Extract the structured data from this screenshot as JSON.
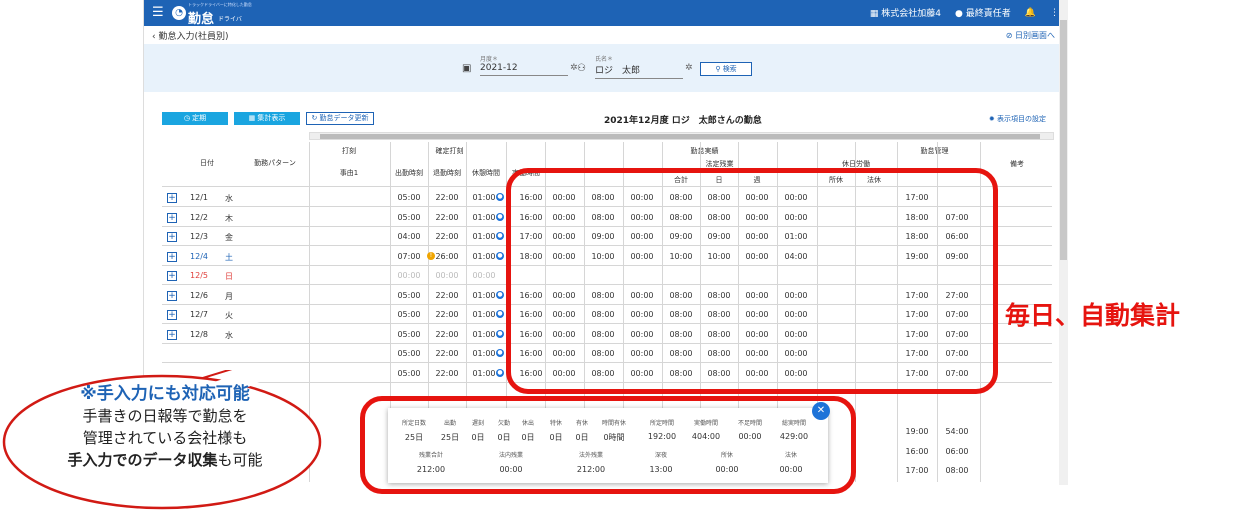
{
  "header": {
    "logo_sub": "トラックドライバーに特化した勤怠",
    "logo_main": "勤怠",
    "logo_small": "ドライバー",
    "company": "株式会社加藤4",
    "user": "最終責任者"
  },
  "breadcrumb": {
    "back_label": "勤怠入力(社員別)",
    "daily_link": "日別画面へ"
  },
  "search": {
    "month_label": "月度＊",
    "month_value": "2021-12",
    "name_label": "氏名＊",
    "name_value": "ロジ　太郎",
    "search_button": "検索"
  },
  "toolbar": {
    "fix_button": "定期",
    "total_button": "集計表示",
    "update_button": "勤怠データ更新",
    "title": "2021年12月度 ロジ　太郎さんの勤怠",
    "settings_link": "表示項目の設定"
  },
  "table_headers": {
    "date": "日付",
    "pattern": "勤務パターン",
    "punch": "打刻",
    "reason": "事由1",
    "fixed_punch": "確定打刻",
    "start": "出勤時刻",
    "end": "退勤時刻",
    "break": "休憩時間",
    "actual": "勤怠実績",
    "actual_work": "実働時間",
    "legal_ot": "法定残業",
    "total": "合計",
    "day": "日",
    "week": "週",
    "holiday_ot": "休日労働",
    "prescribed": "所休",
    "legal_hol": "法休",
    "mgmt": "勤怠管理",
    "note": "備考"
  },
  "rows": [
    {
      "date": "12/1",
      "dow": "水",
      "start": "05:00",
      "end": "22:00",
      "brk": "01:00",
      "v": [
        "16:00",
        "00:00",
        "08:00",
        "00:00",
        "08:00",
        "08:00",
        "00:00",
        "00:00"
      ],
      "m1": "17:00",
      "m2": ""
    },
    {
      "date": "12/2",
      "dow": "木",
      "start": "05:00",
      "end": "22:00",
      "brk": "01:00",
      "v": [
        "16:00",
        "00:00",
        "08:00",
        "00:00",
        "08:00",
        "08:00",
        "00:00",
        "00:00"
      ],
      "m1": "18:00",
      "m2": "07:00"
    },
    {
      "date": "12/3",
      "dow": "金",
      "start": "04:00",
      "end": "22:00",
      "brk": "01:00",
      "v": [
        "17:00",
        "00:00",
        "09:00",
        "00:00",
        "09:00",
        "09:00",
        "00:00",
        "01:00"
      ],
      "m1": "18:00",
      "m2": "06:00"
    },
    {
      "date": "12/4",
      "dow": "土",
      "start": "07:00",
      "end": "26:00",
      "brk": "01:00",
      "v": [
        "18:00",
        "00:00",
        "10:00",
        "00:00",
        "10:00",
        "10:00",
        "00:00",
        "04:00"
      ],
      "m1": "19:00",
      "m2": "09:00"
    },
    {
      "date": "12/5",
      "dow": "日",
      "start": "00:00",
      "end": "00:00",
      "brk": "00:00",
      "v": [
        "",
        "",
        "",
        "",
        "",
        "",
        "",
        ""
      ],
      "m1": "",
      "m2": ""
    },
    {
      "date": "12/6",
      "dow": "月",
      "start": "05:00",
      "end": "22:00",
      "brk": "01:00",
      "v": [
        "16:00",
        "00:00",
        "08:00",
        "00:00",
        "08:00",
        "08:00",
        "00:00",
        "00:00"
      ],
      "m1": "17:00",
      "m2": "27:00"
    },
    {
      "date": "12/7",
      "dow": "火",
      "start": "05:00",
      "end": "22:00",
      "brk": "01:00",
      "v": [
        "16:00",
        "00:00",
        "08:00",
        "00:00",
        "08:00",
        "08:00",
        "00:00",
        "00:00"
      ],
      "m1": "17:00",
      "m2": "07:00"
    },
    {
      "date": "12/8",
      "dow": "水",
      "start": "05:00",
      "end": "22:00",
      "brk": "01:00",
      "v": [
        "16:00",
        "00:00",
        "08:00",
        "00:00",
        "08:00",
        "08:00",
        "00:00",
        "00:00"
      ],
      "m1": "17:00",
      "m2": "07:00"
    },
    {
      "date": "",
      "dow": "",
      "start": "05:00",
      "end": "22:00",
      "brk": "01:00",
      "v": [
        "16:00",
        "00:00",
        "08:00",
        "00:00",
        "08:00",
        "08:00",
        "00:00",
        "00:00"
      ],
      "m1": "17:00",
      "m2": "07:00"
    },
    {
      "date": "",
      "dow": "",
      "start": "05:00",
      "end": "22:00",
      "brk": "01:00",
      "v": [
        "16:00",
        "00:00",
        "08:00",
        "00:00",
        "08:00",
        "08:00",
        "00:00",
        "00:00"
      ],
      "m1": "17:00",
      "m2": "07:00"
    }
  ],
  "extra_rows": [
    {
      "m1": "19:00",
      "m2": "54:00"
    },
    {
      "m1": "16:00",
      "m2": "06:00"
    },
    {
      "m1": "17:00",
      "m2": "08:00"
    }
  ],
  "summary": {
    "labels1": [
      "所定日数",
      "出勤",
      "遅刻",
      "欠勤",
      "休出",
      "特休",
      "有休",
      "時間有休",
      "所定時間",
      "実働時間",
      "不足時間",
      "総実時間"
    ],
    "values1": [
      "25日",
      "25日",
      "0日",
      "0日",
      "0日",
      "0日",
      "0日",
      "0時間",
      "192:00",
      "404:00",
      "00:00",
      "429:00"
    ],
    "labels2": [
      "残業合計",
      "法内残業",
      "法外残業",
      "深夜",
      "所休",
      "法休"
    ],
    "values2": [
      "212:00",
      "00:00",
      "212:00",
      "13:00",
      "00:00",
      "00:00"
    ]
  },
  "annotation": {
    "auto_total": "毎日、自動集計",
    "bubble_line1": "※手入力にも対応可能",
    "bubble_line2": "手書きの日報等で勤怠を",
    "bubble_line3": "管理されている会社様も",
    "bubble_line4a": "手入力でのデータ収集",
    "bubble_line4b": "も可能"
  },
  "colors": {
    "primary": "#1e63b5",
    "accent": "#1aa5e0",
    "highlight": "#e6140f"
  }
}
